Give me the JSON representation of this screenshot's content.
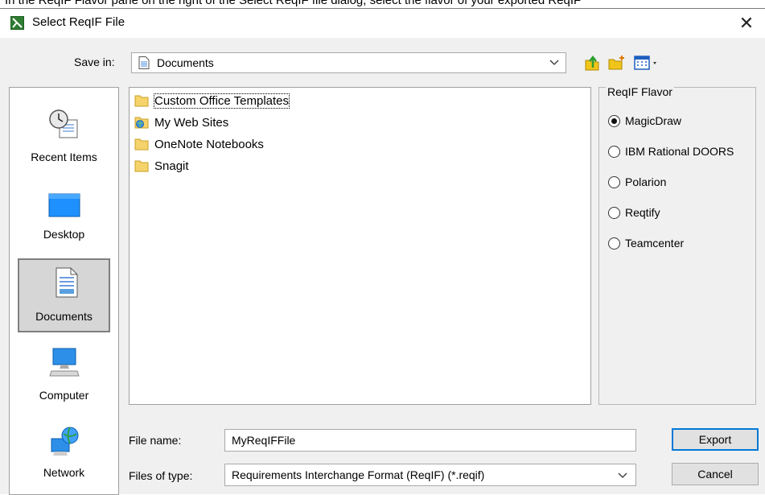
{
  "caption": "In the ReqIF Flavor pane on the right of the Select ReqIF file dialog, select the flavor of your exported ReqIF",
  "window": {
    "title": "Select ReqIF File",
    "close_glyph": "✕"
  },
  "save_in": {
    "label": "Save in:",
    "value": "Documents"
  },
  "toolbar": {
    "icons": [
      "up-one-level-icon",
      "new-folder-icon",
      "view-menu-icon"
    ]
  },
  "places": [
    {
      "label": "Recent Items",
      "icon": "recent-items-icon"
    },
    {
      "label": "Desktop",
      "icon": "desktop-icon"
    },
    {
      "label": "Documents",
      "icon": "documents-icon",
      "selected": true
    },
    {
      "label": "Computer",
      "icon": "computer-icon"
    },
    {
      "label": "Network",
      "icon": "network-icon"
    }
  ],
  "files": [
    {
      "name": "Custom Office Templates",
      "icon": "folder-icon",
      "focused": true
    },
    {
      "name": "My Web Sites",
      "icon": "web-folder-icon"
    },
    {
      "name": "OneNote Notebooks",
      "icon": "folder-icon"
    },
    {
      "name": "Snagit",
      "icon": "folder-icon"
    }
  ],
  "flavor": {
    "legend": "ReqIF Flavor",
    "options": [
      {
        "label": "MagicDraw",
        "checked": true
      },
      {
        "label": "IBM Rational DOORS",
        "checked": false
      },
      {
        "label": "Polarion",
        "checked": false
      },
      {
        "label": "Reqtify",
        "checked": false
      },
      {
        "label": "Teamcenter",
        "checked": false
      }
    ]
  },
  "file_name": {
    "label": "File name:",
    "value": "MyReqIFFile"
  },
  "file_type": {
    "label": "Files of type:",
    "value": "Requirements Interchange Format (ReqIF) (*.reqif)"
  },
  "buttons": {
    "export": "Export",
    "cancel": "Cancel"
  },
  "colors": {
    "accent": "#0078d7",
    "dialog_bg": "#f0f0f0",
    "folder": "#f5d36a"
  }
}
